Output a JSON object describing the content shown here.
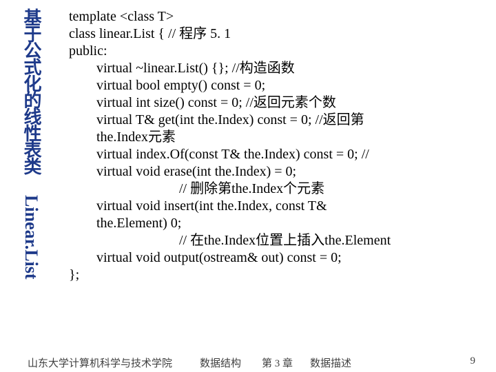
{
  "sidebar": {
    "title_cn": "基于公式化的线性表类",
    "title_en": "Linear.List"
  },
  "code": {
    "l1": "template <class T>",
    "l2": "class  linear.List {  // 程序 5. 1",
    "l3": "public:",
    "l4": "virtual ~linear.List() {}; //构造函数",
    "l5": "virtual bool empty() const  = 0;",
    "l6": "virtual int size() const = 0; //返回元素个数",
    "l7": "virtual T& get(int the.Index) const = 0; //返回第",
    "l8": "the.Index元素",
    "l9": "virtual index.Of(const T&  the.Index) const = 0; //",
    "l10": "virtual void erase(int the.Index) = 0;",
    "l11": "// 删除第the.Index个元素",
    "l12": "virtual void insert(int the.Index, const T&",
    "l13": "the.Element)  0;",
    "l14": "// 在the.Index位置上插入the.Element",
    "l15": "virtual void output(ostream& out) const = 0;",
    "l16": "};"
  },
  "footer": {
    "left": "山东大学计算机科学与技术学院",
    "mid1": "数据结构",
    "mid2": "第 3 章",
    "mid3": "数据描述",
    "page": "9"
  }
}
